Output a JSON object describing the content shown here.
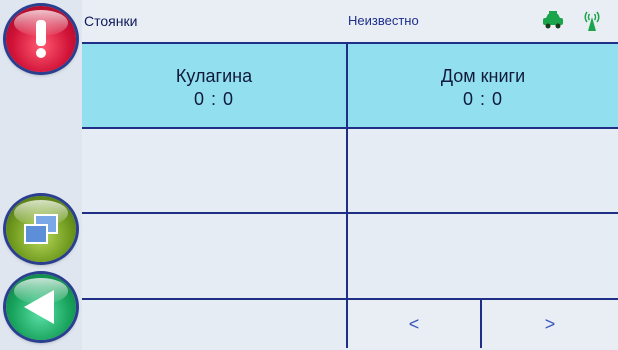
{
  "header": {
    "title": "Стоянки",
    "status": "Неизвестно"
  },
  "icons": {
    "alert": "alert-exclamation-icon",
    "windows": "windows-icon",
    "back": "back-arrow-icon",
    "taxi": "taxi-icon",
    "signal": "signal-icon"
  },
  "colors": {
    "frame_blue": "#1f2f86",
    "cell_filled": "#92dff0",
    "background": "#e6ecf4"
  },
  "parkings": [
    {
      "name": "Кулагина",
      "count": "0 : 0"
    },
    {
      "name": "Дом книги",
      "count": "0 : 0"
    },
    {
      "name": "",
      "count": ""
    },
    {
      "name": "",
      "count": ""
    },
    {
      "name": "",
      "count": ""
    },
    {
      "name": "",
      "count": ""
    }
  ],
  "pager": {
    "prev_label": "<",
    "next_label": ">"
  }
}
